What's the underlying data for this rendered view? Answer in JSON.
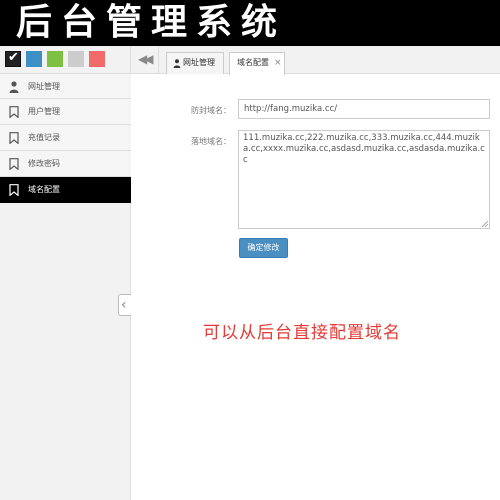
{
  "header": {
    "title": "后台管理系统"
  },
  "theme_swatches": [
    {
      "color": "#222222",
      "icon": "check-icon",
      "selected": true
    },
    {
      "color": "#3d8fc6"
    },
    {
      "color": "#7cc142"
    },
    {
      "color": "#cccccc"
    },
    {
      "color": "#f26a6a"
    }
  ],
  "sidebar": {
    "items": [
      {
        "label": "网址管理",
        "icon": "user-icon"
      },
      {
        "label": "用户管理",
        "icon": "bookmark-icon"
      },
      {
        "label": "充值记录",
        "icon": "bookmark-icon"
      },
      {
        "label": "修改密码",
        "icon": "bookmark-icon"
      },
      {
        "label": "域名配置",
        "icon": "bookmark-icon",
        "active": true
      }
    ]
  },
  "tabs": [
    {
      "label": "网址管理",
      "icon": "user-icon"
    },
    {
      "label": "域名配置",
      "active": true,
      "closable": true
    }
  ],
  "form": {
    "anti_block_label": "防封域名：",
    "anti_block_value": "http://fang.muzika.cc/",
    "landing_label": "落地域名：",
    "landing_value": "111.muzika.cc,222.muzika.cc,333.muzika.cc,444.muzika.cc,xxxx.muzika.cc,asdasd.muzika.cc,asdasda.muzika.cc",
    "submit_label": "确定修改"
  },
  "note": "可以从后台直接配置域名",
  "colors": {
    "header_bg": "#000000",
    "active_nav_bg": "#000000",
    "button_bg": "#4a8fc2",
    "note_text": "#e53935"
  }
}
